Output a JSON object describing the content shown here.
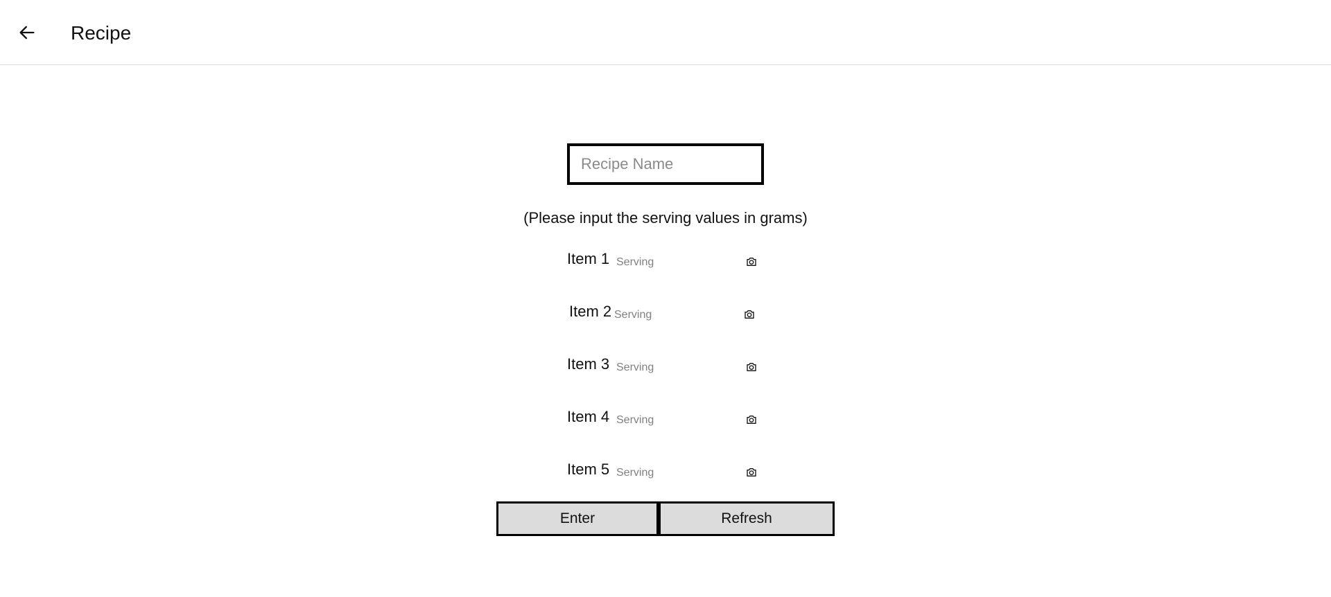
{
  "header": {
    "title": "Recipe",
    "back_icon": "arrow-left-icon"
  },
  "form": {
    "recipe_name_placeholder": "Recipe Name",
    "recipe_name_value": "",
    "instruction": "(Please input the serving values in grams)",
    "items": [
      {
        "label": "Item 1",
        "serving_placeholder": "Serving",
        "serving_value": "",
        "icon": "camera-icon"
      },
      {
        "label": "Item 2",
        "serving_placeholder": "Serving",
        "serving_value": "",
        "icon": "camera-icon"
      },
      {
        "label": "Item 3",
        "serving_placeholder": "Serving",
        "serving_value": "",
        "icon": "camera-icon"
      },
      {
        "label": "Item 4",
        "serving_placeholder": "Serving",
        "serving_value": "",
        "icon": "camera-icon"
      },
      {
        "label": "Item 5",
        "serving_placeholder": "Serving",
        "serving_value": "",
        "icon": "camera-icon"
      }
    ]
  },
  "actions": {
    "enter_label": "Enter",
    "refresh_label": "Refresh"
  },
  "colors": {
    "button_bg": "#dcdcdc",
    "border": "#000000",
    "placeholder": "#808080"
  }
}
